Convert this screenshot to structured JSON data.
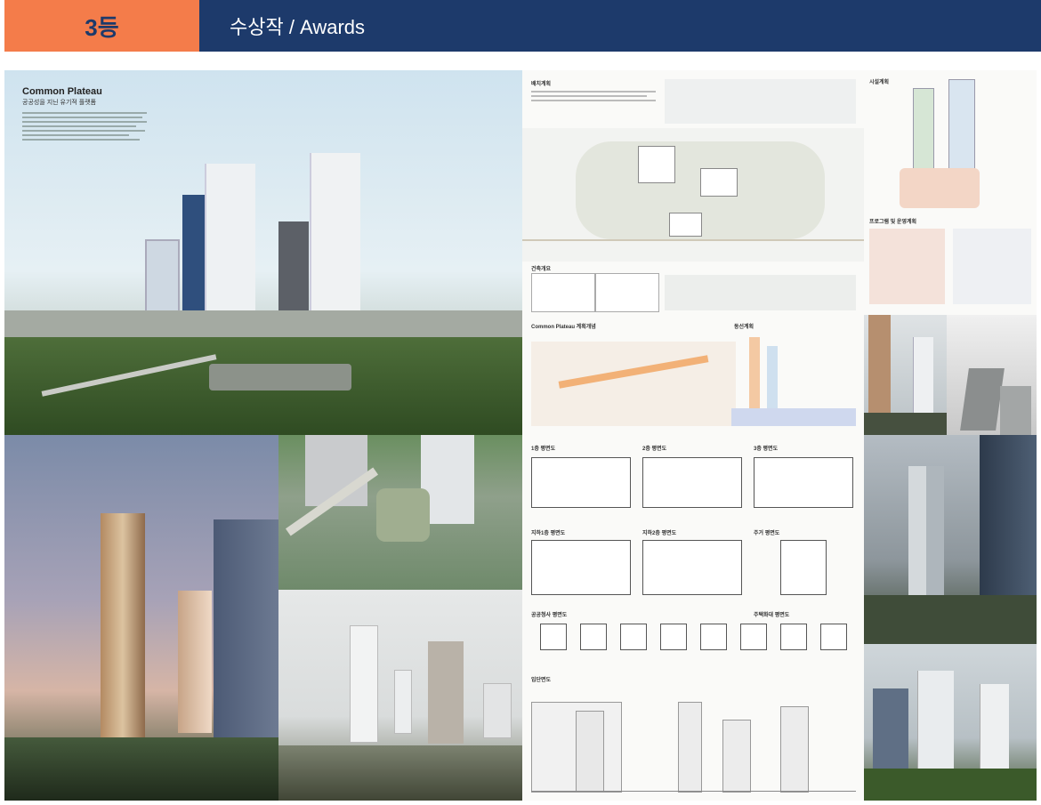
{
  "header": {
    "rank": "3등",
    "title": "수상작 / Awards"
  },
  "main_render": {
    "title": "Common Plateau",
    "subtitle": "공공성을 지닌 유기적 플랫폼"
  },
  "sheet": {
    "site_plan_label": "배치계획",
    "concept_label": "Common Plateau 계획개념",
    "circulation_label": "동선계획",
    "facility_label": "시설계획",
    "program_label": "프로그램 및 운영계획",
    "floor_labels": [
      "1층 평면도",
      "2층 평면도",
      "3층 평면도",
      "지하1층 평면도",
      "지하2층 평면도",
      "주거 평면도"
    ],
    "public_plan_label": "공공청사 평면도",
    "residence_plan_label": "주택화대 평면도",
    "elevation_label": "입단면도",
    "overview_label": "건축개요"
  },
  "colors": {
    "rank_bg": "#f47c4a",
    "rank_text": "#1d3a6b",
    "bar_bg": "#1d3a6b",
    "bar_text": "#ffffff"
  }
}
